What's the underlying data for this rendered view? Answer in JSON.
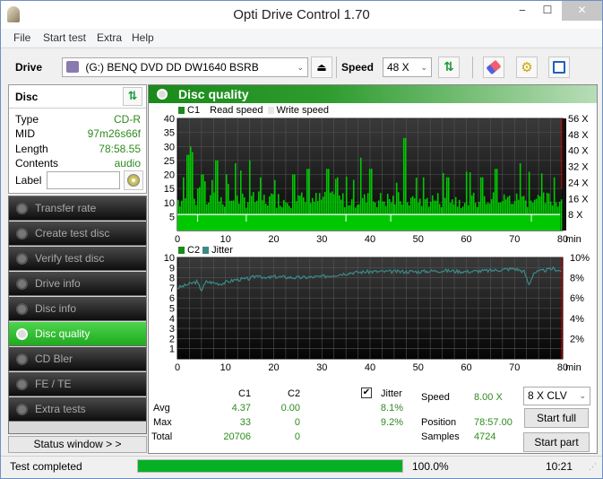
{
  "window": {
    "title": "Opti Drive Control 1.70",
    "minimize": "‒",
    "maximize": "☐",
    "close": "✕"
  },
  "menu": [
    "File",
    "Start test",
    "Extra",
    "Help"
  ],
  "toolbar": {
    "drive_label": "Drive",
    "drive_value": "(G:)   BENQ DVD DD DW1640 BSRB",
    "speed_label": "Speed",
    "speed_value": "48 X"
  },
  "disc": {
    "title": "Disc",
    "rows": [
      {
        "key": "Type",
        "value": "CD-R"
      },
      {
        "key": "MID",
        "value": "97m26s66f"
      },
      {
        "key": "Length",
        "value": "78:58.55"
      },
      {
        "key": "Contents",
        "value": "audio"
      }
    ],
    "label_key": "Label",
    "label_value": ""
  },
  "nav": [
    {
      "label": "Transfer rate",
      "active": false
    },
    {
      "label": "Create test disc",
      "active": false
    },
    {
      "label": "Verify test disc",
      "active": false
    },
    {
      "label": "Drive info",
      "active": false
    },
    {
      "label": "Disc info",
      "active": false
    },
    {
      "label": "Disc quality",
      "active": true
    },
    {
      "label": "CD Bler",
      "active": false
    },
    {
      "label": "FE / TE",
      "active": false
    },
    {
      "label": "Extra tests",
      "active": false
    }
  ],
  "status_window_label": "Status window > >",
  "panel": {
    "title": "Disc quality"
  },
  "colors": {
    "c1": "#00c800",
    "jitter": "#3a8a8a",
    "speed_line": "#ffffff",
    "position_marker": "#e00000",
    "accent": "#2e8b1e"
  },
  "chart_data": [
    {
      "type": "bar",
      "title": "C1",
      "legend": [
        "C1",
        "Read speed",
        "Write speed"
      ],
      "x_ticks": [
        "0",
        "10",
        "20",
        "30",
        "40",
        "50",
        "60",
        "70",
        "80"
      ],
      "x_unit": "min",
      "xlim": [
        0,
        80
      ],
      "y_ticks": [
        "5",
        "10",
        "15",
        "20",
        "25",
        "30",
        "35",
        "40"
      ],
      "ylim": [
        0,
        40
      ],
      "y2_ticks": [
        "8 X",
        "16 X",
        "24 X",
        "32 X",
        "40 X",
        "48 X",
        "56 X"
      ],
      "y2lim": [
        0,
        56
      ],
      "read_speed_x": 8,
      "c1_avg": 4.37,
      "c1_max": 33,
      "sample_peaks": [
        [
          1,
          19
        ],
        [
          2,
          27
        ],
        [
          2.5,
          30
        ],
        [
          3,
          28
        ],
        [
          5,
          20
        ],
        [
          7,
          18
        ],
        [
          8,
          25
        ],
        [
          10,
          20
        ],
        [
          12,
          24
        ],
        [
          15,
          25
        ],
        [
          17,
          19
        ],
        [
          20,
          18
        ],
        [
          24,
          20
        ],
        [
          27,
          22
        ],
        [
          31,
          22
        ],
        [
          33,
          19
        ],
        [
          38,
          26
        ],
        [
          40,
          22
        ],
        [
          47,
          33
        ],
        [
          51,
          19
        ],
        [
          56,
          19
        ],
        [
          63,
          19
        ],
        [
          66,
          22
        ],
        [
          71,
          24
        ],
        [
          73,
          21
        ],
        [
          78,
          19
        ],
        [
          80,
          14
        ]
      ]
    },
    {
      "type": "line",
      "title": "C2 / Jitter",
      "legend": [
        "C2",
        "Jitter"
      ],
      "x_ticks": [
        "0",
        "10",
        "20",
        "30",
        "40",
        "50",
        "60",
        "70",
        "80"
      ],
      "x_unit": "min",
      "xlim": [
        0,
        80
      ],
      "y_ticks": [
        "1",
        "2",
        "3",
        "4",
        "5",
        "6",
        "7",
        "8",
        "9",
        "10"
      ],
      "ylim": [
        0,
        10
      ],
      "y2_ticks": [
        "2%",
        "4%",
        "6%",
        "8%",
        "10%"
      ],
      "y2lim": [
        0,
        10
      ],
      "jitter_points": [
        [
          0,
          7.0
        ],
        [
          2,
          7.3
        ],
        [
          4,
          7.6
        ],
        [
          5,
          6.8
        ],
        [
          6,
          7.6
        ],
        [
          9,
          7.4
        ],
        [
          12,
          7.8
        ],
        [
          15,
          7.9
        ],
        [
          17,
          8.3
        ],
        [
          18,
          7.9
        ],
        [
          20,
          8.1
        ],
        [
          25,
          8.0
        ],
        [
          30,
          8.1
        ],
        [
          33,
          8.3
        ],
        [
          36,
          8.5
        ],
        [
          40,
          8.6
        ],
        [
          45,
          8.6
        ],
        [
          50,
          8.6
        ],
        [
          55,
          8.7
        ],
        [
          60,
          8.6
        ],
        [
          65,
          8.7
        ],
        [
          70,
          8.9
        ],
        [
          72,
          8.6
        ],
        [
          73,
          7.3
        ],
        [
          74,
          8.5
        ],
        [
          76,
          8.7
        ],
        [
          78,
          8.9
        ],
        [
          80,
          8.6
        ]
      ],
      "c2_values": 0
    }
  ],
  "stats": {
    "col_c1": "C1",
    "col_c2": "C2",
    "jitter_label": "Jitter",
    "jitter_checked": true,
    "rows": [
      {
        "label": "Avg",
        "c1": "4.37",
        "c2": "0.00",
        "jitter": "8.1%"
      },
      {
        "label": "Max",
        "c1": "33",
        "c2": "0",
        "jitter": "9.2%"
      },
      {
        "label": "Total",
        "c1": "20706",
        "c2": "0",
        "jitter": ""
      }
    ],
    "speed_label": "Speed",
    "speed_value": "8.00 X",
    "position_label": "Position",
    "position_value": "78:57.00",
    "samples_label": "Samples",
    "samples_value": "4724",
    "speed_mode": "8 X CLV",
    "start_full": "Start full",
    "start_part": "Start part"
  },
  "statusbar": {
    "text": "Test completed",
    "progress": 100.0,
    "progress_label": "100.0%",
    "time": "10:21"
  }
}
